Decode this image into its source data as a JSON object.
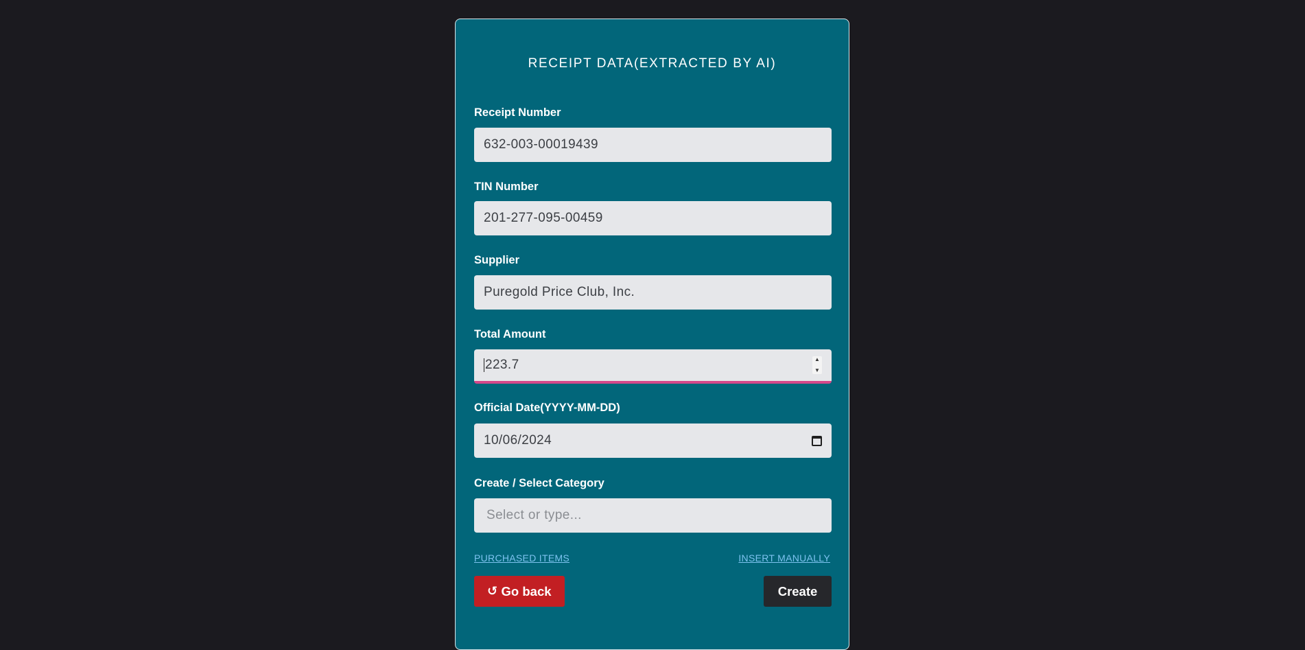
{
  "form": {
    "title": "RECEIPT DATA(EXTRACTED BY AI)",
    "receipt_number": {
      "label": "Receipt Number",
      "value": "632-003-00019439"
    },
    "tin_number": {
      "label": "TIN Number",
      "value": "201-277-095-00459"
    },
    "supplier": {
      "label": "Supplier",
      "value": "Puregold Price Club, Inc."
    },
    "total_amount": {
      "label": "Total Amount",
      "value": "223.7"
    },
    "official_date": {
      "label": "Official Date(YYYY-MM-DD)",
      "value": "10/06/2024"
    },
    "category": {
      "label": "Create / Select Category",
      "placeholder": "Select or type..."
    },
    "links": {
      "purchased_items": "PURCHASED ITEMS",
      "insert_manually": "INSERT MANUALLY"
    },
    "buttons": {
      "go_back": "Go back",
      "create": "Create"
    }
  },
  "colors": {
    "background": "#1b1a1f",
    "card": "#02667a",
    "field": "#e6e7ea",
    "focus_underline": "#d6488a",
    "back_button": "#c21f23",
    "create_button": "#26272b",
    "link": "#7dc2ef"
  },
  "icons": {
    "go_back": "undo-icon",
    "date": "calendar-icon",
    "number": "spinner-icon"
  }
}
